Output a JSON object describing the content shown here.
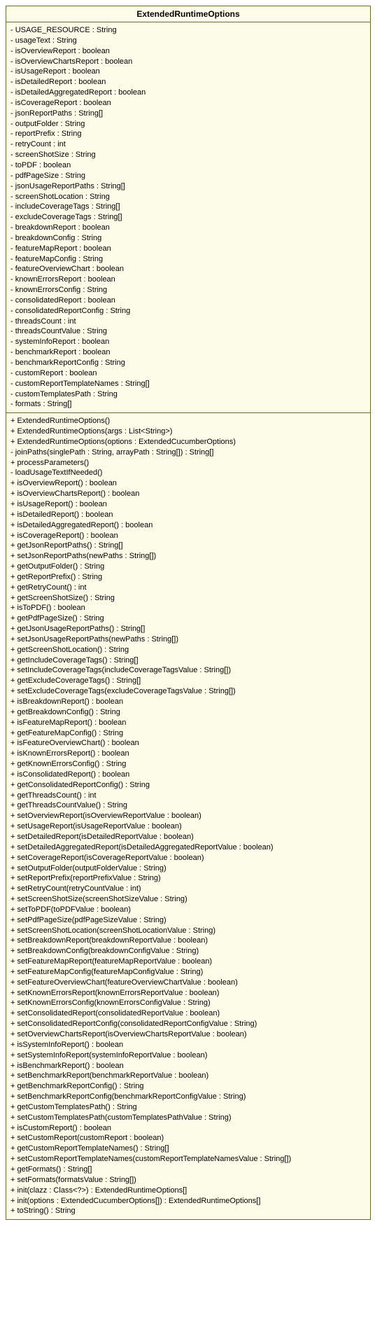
{
  "className": "ExtendedRuntimeOptions",
  "attributes": [
    "- USAGE_RESOURCE : String",
    "- usageText : String",
    "- isOverviewReport : boolean",
    "- isOverviewChartsReport : boolean",
    "- isUsageReport : boolean",
    "- isDetailedReport : boolean",
    "- isDetailedAggregatedReport : boolean",
    "- isCoverageReport : boolean",
    "- jsonReportPaths : String[]",
    "- outputFolder : String",
    "- reportPrefix : String",
    "- retryCount : int",
    "- screenShotSize : String",
    "- toPDF : boolean",
    "- pdfPageSize : String",
    "- jsonUsageReportPaths : String[]",
    "- screenShotLocation : String",
    "- includeCoverageTags : String[]",
    "- excludeCoverageTags : String[]",
    "- breakdownReport : boolean",
    "- breakdownConfig : String",
    "- featureMapReport : boolean",
    "- featureMapConfig : String",
    "- featureOverviewChart : boolean",
    "- knownErrorsReport : boolean",
    "- knownErrorsConfig : String",
    "- consolidatedReport : boolean",
    "- consolidatedReportConfig : String",
    "- threadsCount : int",
    "- threadsCountValue : String",
    "- systemInfoReport : boolean",
    "- benchmarkReport : boolean",
    "- benchmarkReportConfig : String",
    "- customReport : boolean",
    "- customReportTemplateNames : String[]",
    "- customTemplatesPath : String",
    "- formats : String[]"
  ],
  "methods": [
    "+ ExtendedRuntimeOptions()",
    "+ ExtendedRuntimeOptions(args : List<String>)",
    "+ ExtendedRuntimeOptions(options : ExtendedCucumberOptions)",
    "- joinPaths(singlePath : String, arrayPath : String[]) : String[]",
    "+ processParameters()",
    "- loadUsageTextIfNeeded()",
    "+ isOverviewReport() : boolean",
    "+ isOverviewChartsReport() : boolean",
    "+ isUsageReport() : boolean",
    "+ isDetailedReport() : boolean",
    "+ isDetailedAggregatedReport() : boolean",
    "+ isCoverageReport() : boolean",
    "+ getJsonReportPaths() : String[]",
    "+ setJsonReportPaths(newPaths : String[])",
    "+ getOutputFolder() : String",
    "+ getReportPrefix() : String",
    "+ getRetryCount() : int",
    "+ getScreenShotSize() : String",
    "+ isToPDF() : boolean",
    "+ getPdfPageSize() : String",
    "+ getJsonUsageReportPaths() : String[]",
    "+ setJsonUsageReportPaths(newPaths : String[])",
    "+ getScreenShotLocation() : String",
    "+ getIncludeCoverageTags() : String[]",
    "+ setIncludeCoverageTags(includeCoverageTagsValue : String[])",
    "+ getExcludeCoverageTags() : String[]",
    "+ setExcludeCoverageTags(excludeCoverageTagsValue : String[])",
    "+ isBreakdownReport() : boolean",
    "+ getBreakdownConfig() : String",
    "+ isFeatureMapReport() : boolean",
    "+ getFeatureMapConfig() : String",
    "+ isFeatureOverviewChart() : boolean",
    "+ isKnownErrorsReport() : boolean",
    "+ getKnownErrorsConfig() : String",
    "+ isConsolidatedReport() : boolean",
    "+ getConsolidatedReportConfig() : String",
    "+ getThreadsCount() : int",
    "+ getThreadsCountValue() : String",
    "+ setOverviewReport(isOverviewReportValue : boolean)",
    "+ setUsageReport(isUsageReportValue : boolean)",
    "+ setDetailedReport(isDetailedReportValue : boolean)",
    "+ setDetailedAggregatedReport(isDetailedAggregatedReportValue : boolean)",
    "+ setCoverageReport(isCoverageReportValue : boolean)",
    "+ setOutputFolder(outputFolderValue : String)",
    "+ setReportPrefix(reportPrefixValue : String)",
    "+ setRetryCount(retryCountValue : int)",
    "+ setScreenShotSize(screenShotSizeValue : String)",
    "+ setToPDF(toPDFValue : boolean)",
    "+ setPdfPageSize(pdfPageSizeValue : String)",
    "+ setScreenShotLocation(screenShotLocationValue : String)",
    "+ setBreakdownReport(breakdownReportValue : boolean)",
    "+ setBreakdownConfig(breakdownConfigValue : String)",
    "+ setFeatureMapReport(featureMapReportValue : boolean)",
    "+ setFeatureMapConfig(featureMapConfigValue : String)",
    "+ setFeatureOverviewChart(featureOverviewChartValue : boolean)",
    "+ setKnownErrorsReport(knownErrorsReportValue : boolean)",
    "+ setKnownErrorsConfig(knownErrorsConfigValue : String)",
    "+ setConsolidatedReport(consolidatedReportValue : boolean)",
    "+ setConsolidatedReportConfig(consolidatedReportConfigValue : String)",
    "+ setOverviewChartsReport(isOverviewChartsReportValue : boolean)",
    "+ isSystemInfoReport() : boolean",
    "+ setSystemInfoReport(systemInfoReportValue : boolean)",
    "+ isBenchmarkReport() : boolean",
    "+ setBenchmarkReport(benchmarkReportValue : boolean)",
    "+ getBenchmarkReportConfig() : String",
    "+ setBenchmarkReportConfig(benchmarkReportConfigValue : String)",
    "+ getCustomTemplatesPath() : String",
    "+ setCustomTemplatesPath(customTemplatesPathValue : String)",
    "+ isCustomReport() : boolean",
    "+ setCustomReport(customReport : boolean)",
    "+ getCustomReportTemplateNames() : String[]",
    "+ setCustomReportTemplateNames(customReportTemplateNamesValue : String[])",
    "+ getFormats() : String[]",
    "+ setFormats(formatsValue : String[])",
    "+ init(clazz : Class<?>) : ExtendedRuntimeOptions[]",
    "+ init(options : ExtendedCucumberOptions[]) : ExtendedRuntimeOptions[]",
    "+ toString() : String"
  ]
}
